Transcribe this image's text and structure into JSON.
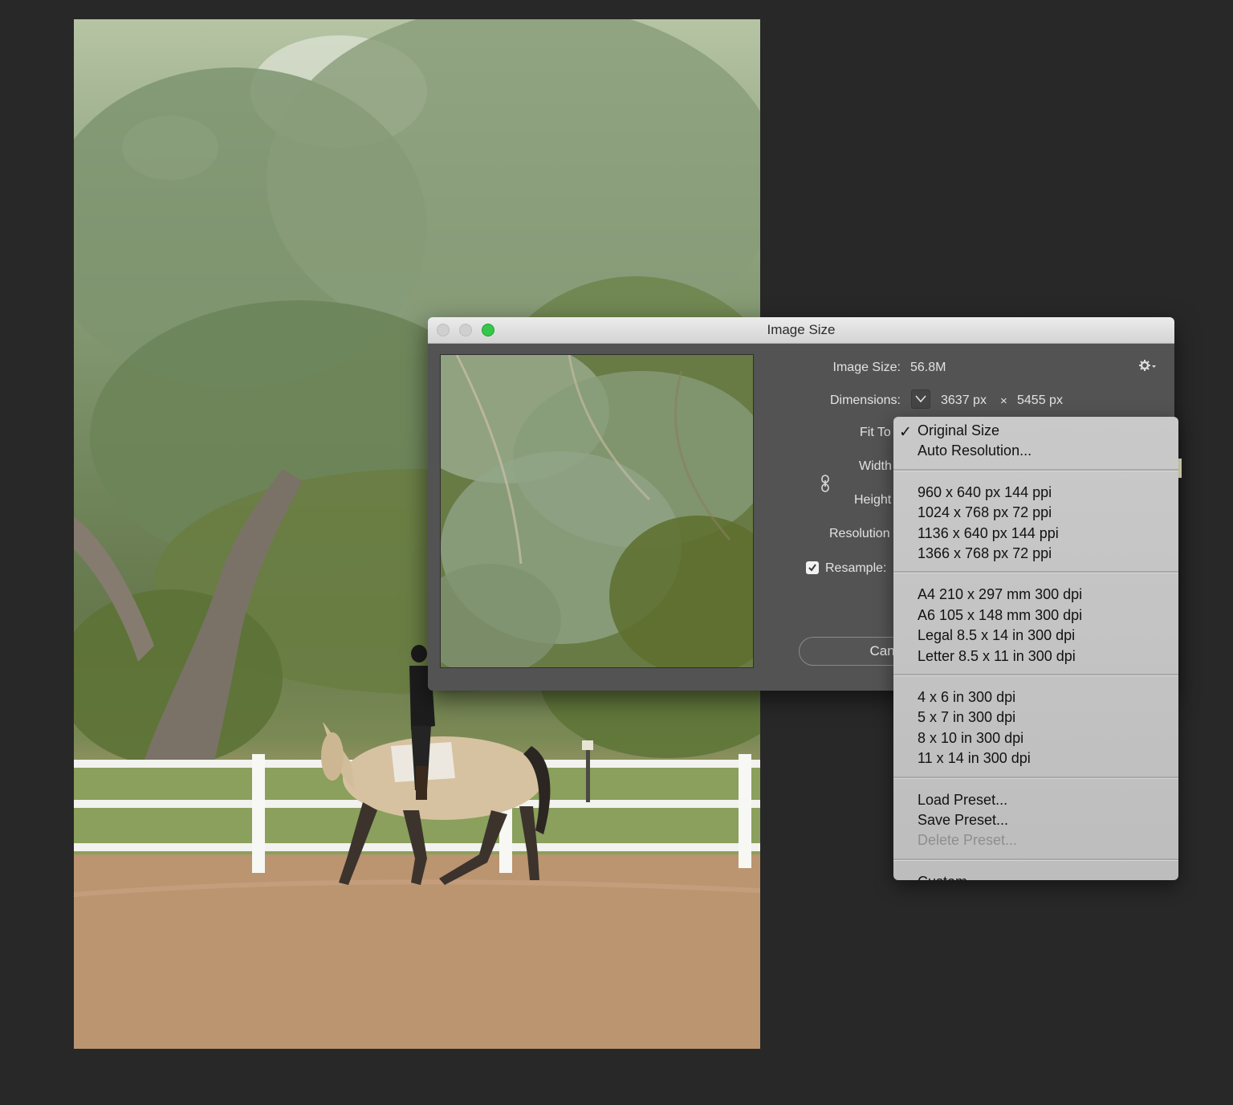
{
  "dialog": {
    "title": "Image Size",
    "image_size_label": "Image Size:",
    "image_size_value": "56.8M",
    "dimensions_label": "Dimensions:",
    "width_px": "3637 px",
    "times": "×",
    "height_px": "5455 px",
    "fit_to_label": "Fit To",
    "width_label": "Width",
    "height_label": "Height",
    "resolution_label": "Resolution",
    "resample_label": "Resample:",
    "resample_checked": true,
    "cancel_label": "Cancel"
  },
  "menu": {
    "groups": [
      [
        "Original Size",
        "Auto Resolution..."
      ],
      [
        "960 x 640 px 144 ppi",
        "1024 x 768 px 72 ppi",
        "1136 x 640 px 144 ppi",
        "1366 x 768 px 72 ppi"
      ],
      [
        "A4 210 x 297 mm 300 dpi",
        "A6 105 x 148 mm 300 dpi",
        "Legal 8.5 x 14 in 300 dpi",
        "Letter 8.5 x 11 in 300 dpi"
      ],
      [
        "4 x 6 in 300 dpi",
        "5 x 7 in 300 dpi",
        "8 x 10 in 300 dpi",
        "11 x 14 in 300 dpi"
      ],
      [
        "Load Preset...",
        "Save Preset...",
        "Delete Preset..."
      ],
      [
        "Custom"
      ]
    ],
    "selected": "Original Size",
    "disabled": [
      "Delete Preset..."
    ]
  },
  "icons": {
    "checkmark": "checkmark-icon",
    "gear": "gear-icon",
    "chevron": "chevron-down-icon",
    "link": "link-icon"
  },
  "colors": {
    "dialog_bg": "#535353",
    "menu_bg": "#c4c4c4",
    "zoom_button": "#35c64a",
    "app_bg": "#282828"
  }
}
